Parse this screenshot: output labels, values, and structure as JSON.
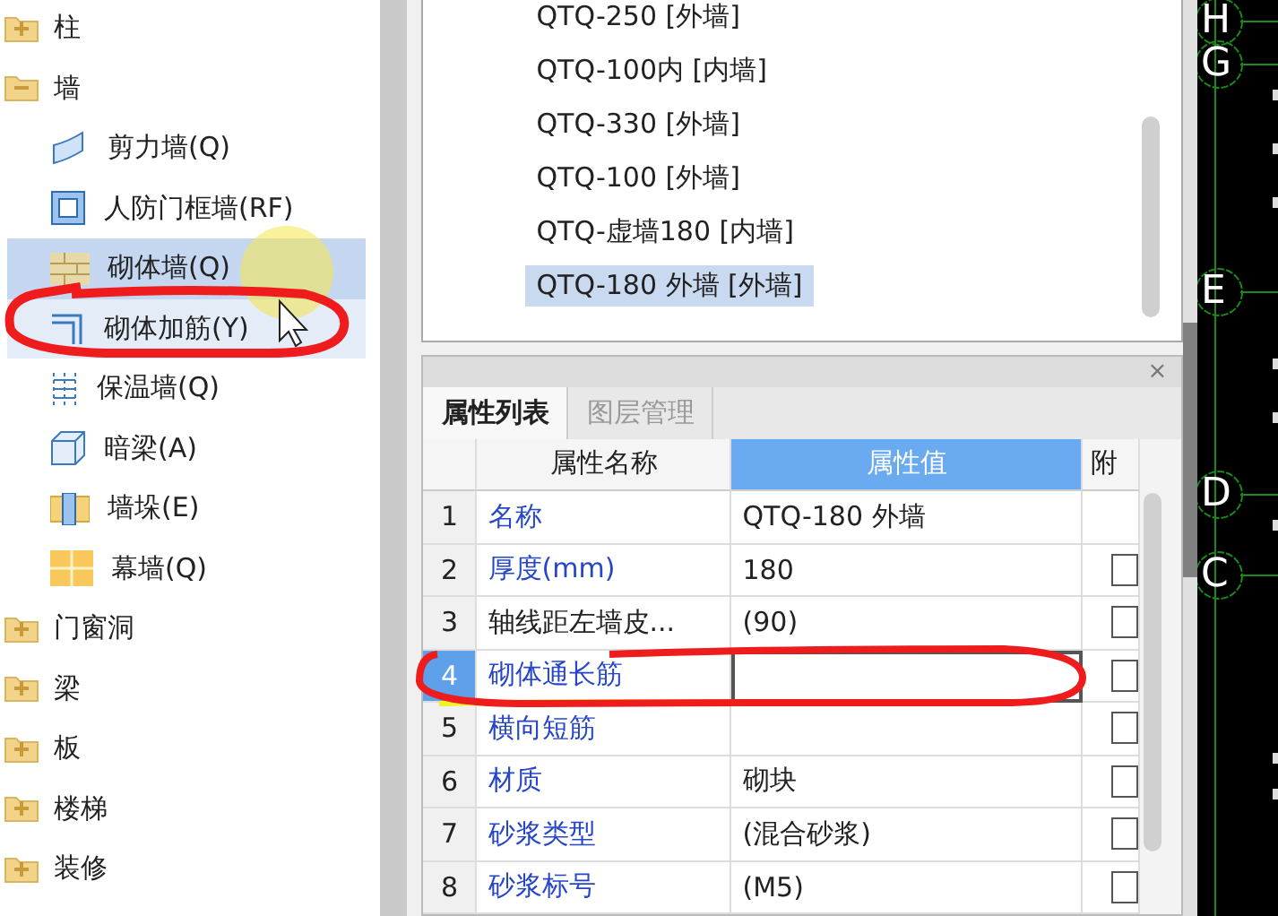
{
  "tree": [
    {
      "label": "柱",
      "expanded": false
    },
    {
      "label": "墙",
      "expanded": true,
      "children": [
        {
          "label": "剪力墙(Q)",
          "kind": "shear",
          "selected": false,
          "hovered": false
        },
        {
          "label": "人防门框墙(RF)",
          "kind": "frame",
          "selected": false,
          "hovered": false
        },
        {
          "label": "砌体墙(Q)",
          "kind": "brick",
          "selected": true,
          "hovered": false
        },
        {
          "label": "砌体加筋(Y)",
          "kind": "rebar",
          "selected": false,
          "hovered": true
        },
        {
          "label": "保温墙(Q)",
          "kind": "insulation",
          "selected": false,
          "hovered": false
        },
        {
          "label": "暗梁(A)",
          "kind": "beam",
          "selected": false,
          "hovered": false
        },
        {
          "label": "墙垛(E)",
          "kind": "pier",
          "selected": false,
          "hovered": false
        },
        {
          "label": "幕墙(Q)",
          "kind": "curtain",
          "selected": false,
          "hovered": false
        }
      ]
    },
    {
      "label": "门窗洞",
      "expanded": false
    },
    {
      "label": "梁",
      "expanded": false
    },
    {
      "label": "板",
      "expanded": false
    },
    {
      "label": "楼梯",
      "expanded": false
    },
    {
      "label": "装修",
      "expanded": false
    }
  ],
  "wall_list": [
    {
      "label": "QTQ-250 [外墙]",
      "selected": false
    },
    {
      "label": "QTQ-100内 [内墙]",
      "selected": false
    },
    {
      "label": "QTQ-330 [外墙]",
      "selected": false
    },
    {
      "label": "QTQ-100 [外墙]",
      "selected": false
    },
    {
      "label": "QTQ-虚墙180 [内墙]",
      "selected": false
    },
    {
      "label": "QTQ-180 外墙 [外墙]",
      "selected": true
    }
  ],
  "properties": {
    "close": "×",
    "tabs": [
      {
        "label": "属性列表",
        "selected": true
      },
      {
        "label": "图层管理",
        "selected": false
      }
    ],
    "columns": [
      "属性名称",
      "属性值",
      "附"
    ],
    "rows": [
      {
        "index": "1",
        "name": "名称",
        "value": "QTQ-180 外墙",
        "public": true,
        "selected": false
      },
      {
        "index": "2",
        "name": "厚度(mm)",
        "value": "180",
        "public": true,
        "selected": false,
        "checked": false
      },
      {
        "index": "3",
        "name": "轴线距左墙皮...",
        "value": "(90)",
        "public": false,
        "selected": false,
        "checked": false
      },
      {
        "index": "4",
        "name": "砌体通长筋",
        "value": "",
        "public": true,
        "selected": true,
        "checked": false
      },
      {
        "index": "5",
        "name": "横向短筋",
        "value": "",
        "public": true,
        "selected": false,
        "checked": false
      },
      {
        "index": "6",
        "name": "材质",
        "value": "砌块",
        "public": true,
        "selected": false,
        "checked": false
      },
      {
        "index": "7",
        "name": "砂浆类型",
        "value": "(混合砂浆)",
        "public": true,
        "selected": false,
        "checked": false
      },
      {
        "index": "8",
        "name": "砂浆标号",
        "value": "(M5)",
        "public": true,
        "selected": false,
        "checked": false
      }
    ]
  },
  "axes": [
    {
      "label": "H"
    },
    {
      "label": "G"
    },
    {
      "label": "E"
    },
    {
      "label": "D"
    },
    {
      "label": "C"
    }
  ]
}
